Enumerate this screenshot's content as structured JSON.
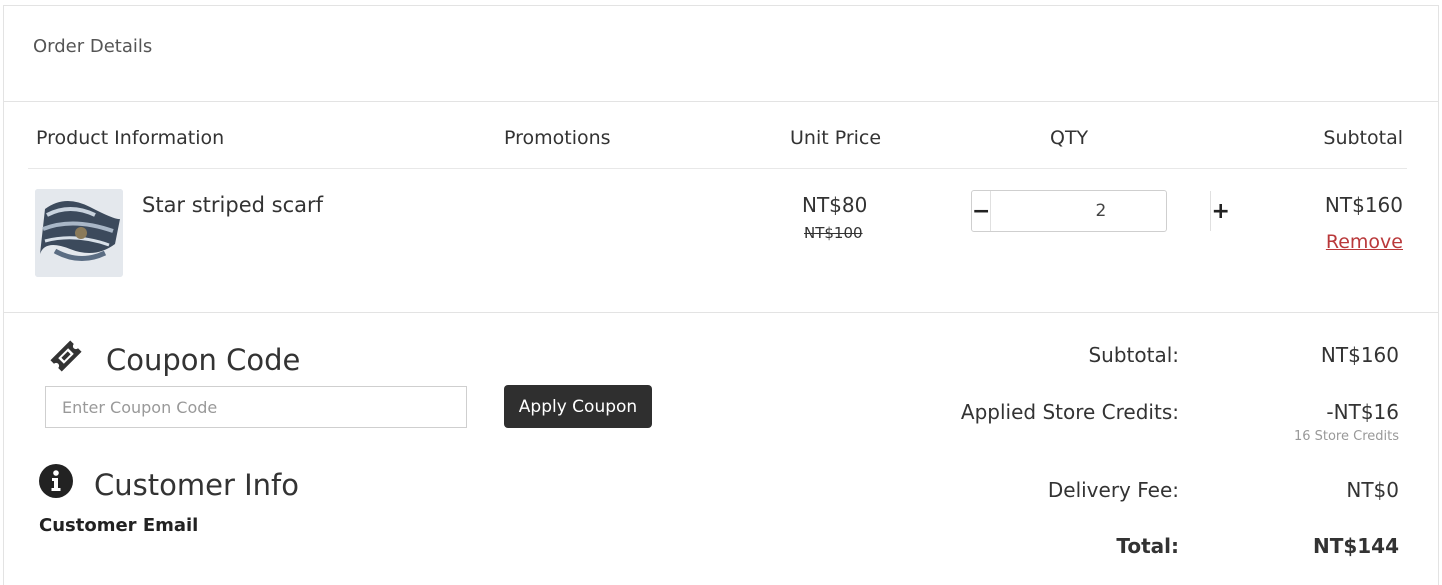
{
  "panel": {
    "title": "Order Details"
  },
  "table": {
    "headers": {
      "product": "Product Information",
      "promotions": "Promotions",
      "unit_price": "Unit Price",
      "qty": "QTY",
      "subtotal": "Subtotal"
    },
    "item": {
      "name": "Star striped scarf",
      "price": "NT$80",
      "original_price": "NT$100",
      "quantity": "2",
      "minus_label": "−",
      "plus_label": "+",
      "subtotal": "NT$160",
      "remove_label": "Remove"
    }
  },
  "coupon": {
    "title": "Coupon Code",
    "placeholder": "Enter Coupon Code",
    "apply_label": "Apply Coupon",
    "icon": "ticket-icon"
  },
  "customer": {
    "title": "Customer Info",
    "email_label": "Customer Email",
    "icon": "info-icon"
  },
  "summary": {
    "subtotal_label": "Subtotal:",
    "subtotal_value": "NT$160",
    "credits_label": "Applied Store Credits:",
    "credits_value": "-NT$16",
    "credits_note": "16 Store Credits",
    "delivery_label": "Delivery Fee:",
    "delivery_value": "NT$0",
    "total_label": "Total:",
    "total_value": "NT$144"
  },
  "colors": {
    "remove_link": "#b9383a",
    "apply_button": "#2f2f2f",
    "border": "#e3e3e3"
  }
}
